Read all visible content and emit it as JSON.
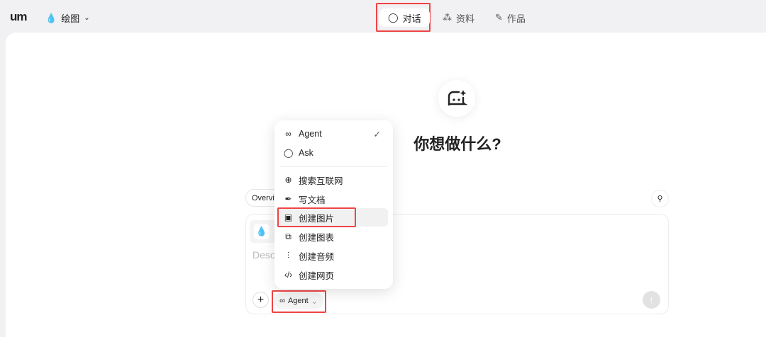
{
  "header": {
    "logo": "um",
    "mode": "绘图",
    "tabs": [
      {
        "label": "对话",
        "icon": "chat-bubble-icon"
      },
      {
        "label": "资料",
        "icon": "sparkle-icon"
      },
      {
        "label": "作品",
        "icon": "magic-wand-icon"
      }
    ]
  },
  "main": {
    "title": "你想做什么?",
    "overview_chip": "Overvi",
    "input_placeholder": "Descr",
    "agent_button": "Agent",
    "plus": "+",
    "send": "↑"
  },
  "menu": {
    "modes": [
      {
        "label": "Agent",
        "icon": "infinity-icon",
        "checked": true
      },
      {
        "label": "Ask",
        "icon": "chat-bubble-icon"
      }
    ],
    "tools": [
      {
        "label": "搜索互联网",
        "icon": "globe-icon"
      },
      {
        "label": "写文档",
        "icon": "pen-nib-icon"
      },
      {
        "label": "创建图片",
        "icon": "image-icon"
      },
      {
        "label": "创建图表",
        "icon": "diagram-icon"
      },
      {
        "label": "创建音频",
        "icon": "audio-icon"
      },
      {
        "label": "创建网页",
        "icon": "code-icon"
      }
    ]
  },
  "colors": {
    "highlight": "#ef4444",
    "background": "#f1f0f3"
  }
}
